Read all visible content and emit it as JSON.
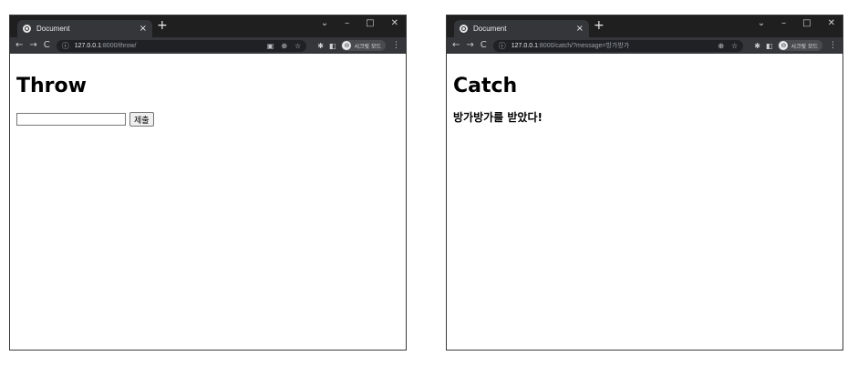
{
  "left_window": {
    "tab_title": "Document",
    "tab_close": "×",
    "new_tab": "+",
    "controls": {
      "chevron": "⌄",
      "minimize": "–",
      "maximize": "□",
      "close": "✕"
    },
    "nav": {
      "back": "←",
      "forward": "→",
      "reload": "C"
    },
    "url_host": "127.0.0.1",
    "url_path": ":8000/throw/",
    "profile_label": "시크릿 모드",
    "avatar_glyph": "⊖",
    "menu": "⋮",
    "page_title": "Throw",
    "input_value": "",
    "submit_label": "제출"
  },
  "right_window": {
    "tab_title": "Document",
    "tab_close": "×",
    "new_tab": "+",
    "controls": {
      "chevron": "⌄",
      "minimize": "–",
      "maximize": "□",
      "close": "✕"
    },
    "nav": {
      "back": "←",
      "forward": "→",
      "reload": "C"
    },
    "url_host": "127.0.0.1",
    "url_path": ":8000/catch/?message=방가방가",
    "profile_label": "시크릿 모드",
    "avatar_glyph": "⊖",
    "menu": "⋮",
    "page_title": "Catch",
    "message": "방가방가를 받았다!"
  },
  "colors": {
    "titlebar": "#1f1f1f",
    "toolbar": "#35363a",
    "omnibox": "#202124"
  }
}
